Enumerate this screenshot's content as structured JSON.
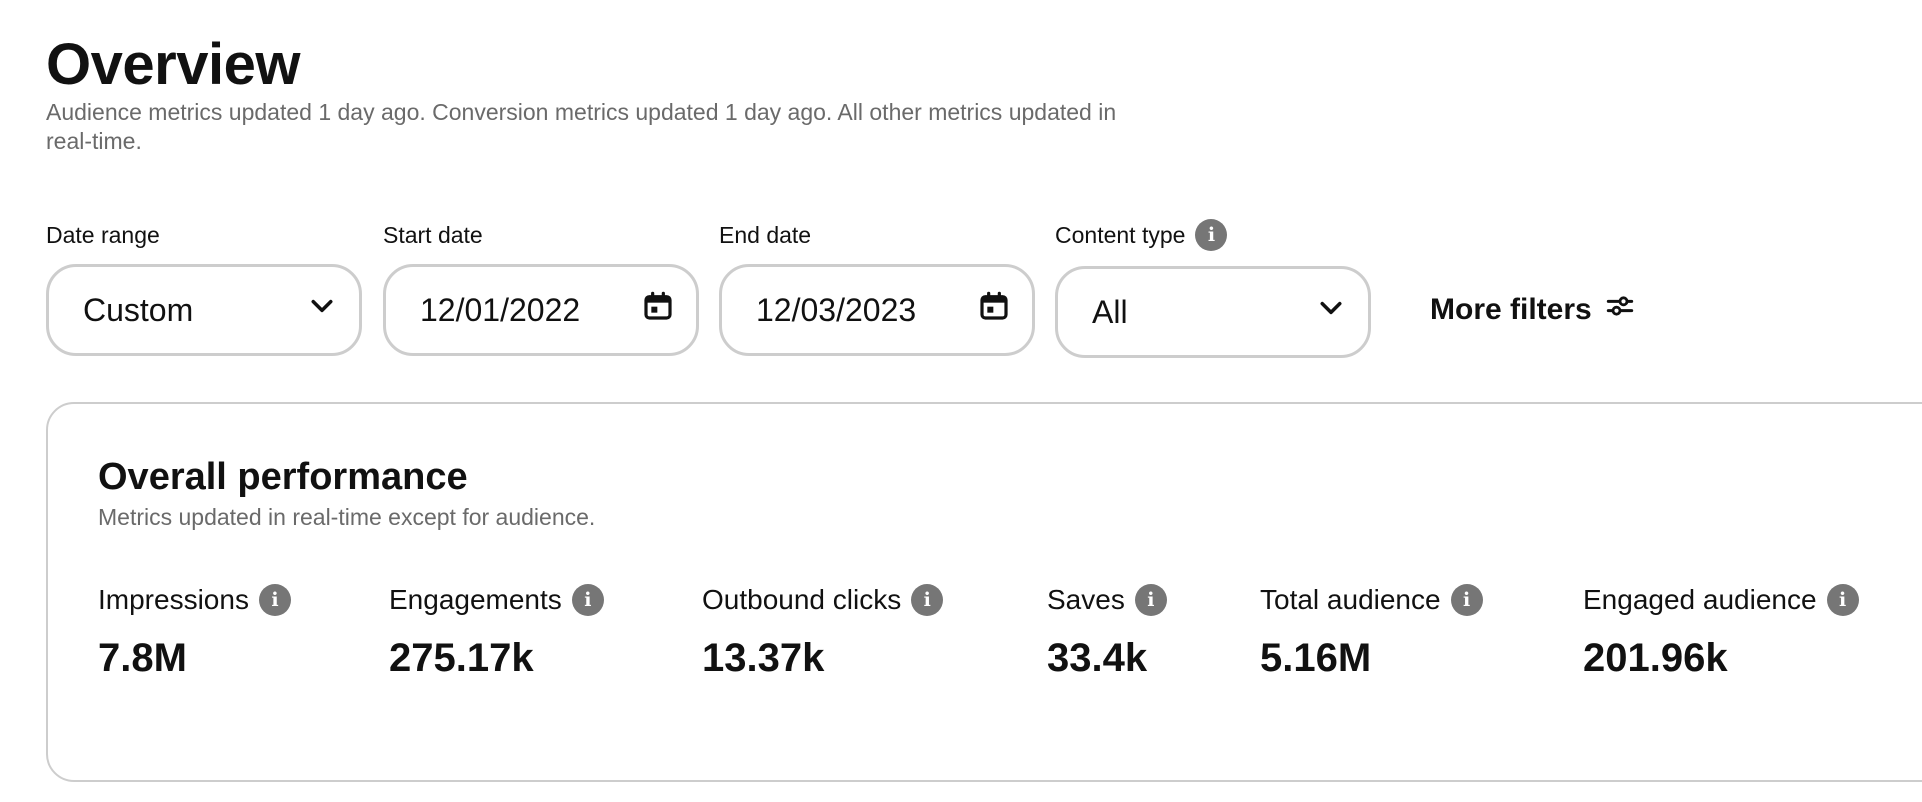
{
  "header": {
    "title": "Overview",
    "subtitle": "Audience metrics updated 1 day ago. Conversion metrics updated 1 day ago. All other metrics updated in real-time."
  },
  "filters": {
    "date_range": {
      "label": "Date range",
      "value": "Custom",
      "icon": "chevron-down-icon"
    },
    "start_date": {
      "label": "Start date",
      "value": "12/01/2022",
      "icon": "calendar-icon"
    },
    "end_date": {
      "label": "End date",
      "value": "12/03/2023",
      "icon": "calendar-icon"
    },
    "content_type": {
      "label": "Content type",
      "value": "All",
      "icon": "chevron-down-icon",
      "info_icon": "info-icon"
    },
    "more_filters": {
      "label": "More filters",
      "icon": "sliders-icon"
    }
  },
  "performance": {
    "title": "Overall performance",
    "subtitle": "Metrics updated in real-time except for audience.",
    "metrics": [
      {
        "label": "Impressions",
        "value": "7.8M"
      },
      {
        "label": "Engagements",
        "value": "275.17k"
      },
      {
        "label": "Outbound clicks",
        "value": "13.37k"
      },
      {
        "label": "Saves",
        "value": "33.4k"
      },
      {
        "label": "Total audience",
        "value": "5.16M"
      },
      {
        "label": "Engaged audience",
        "value": "201.96k"
      }
    ]
  },
  "colors": {
    "text": "#111111",
    "muted_text": "#6a6a6a",
    "border": "#cdcdcd",
    "info_icon_bg": "#767676"
  }
}
